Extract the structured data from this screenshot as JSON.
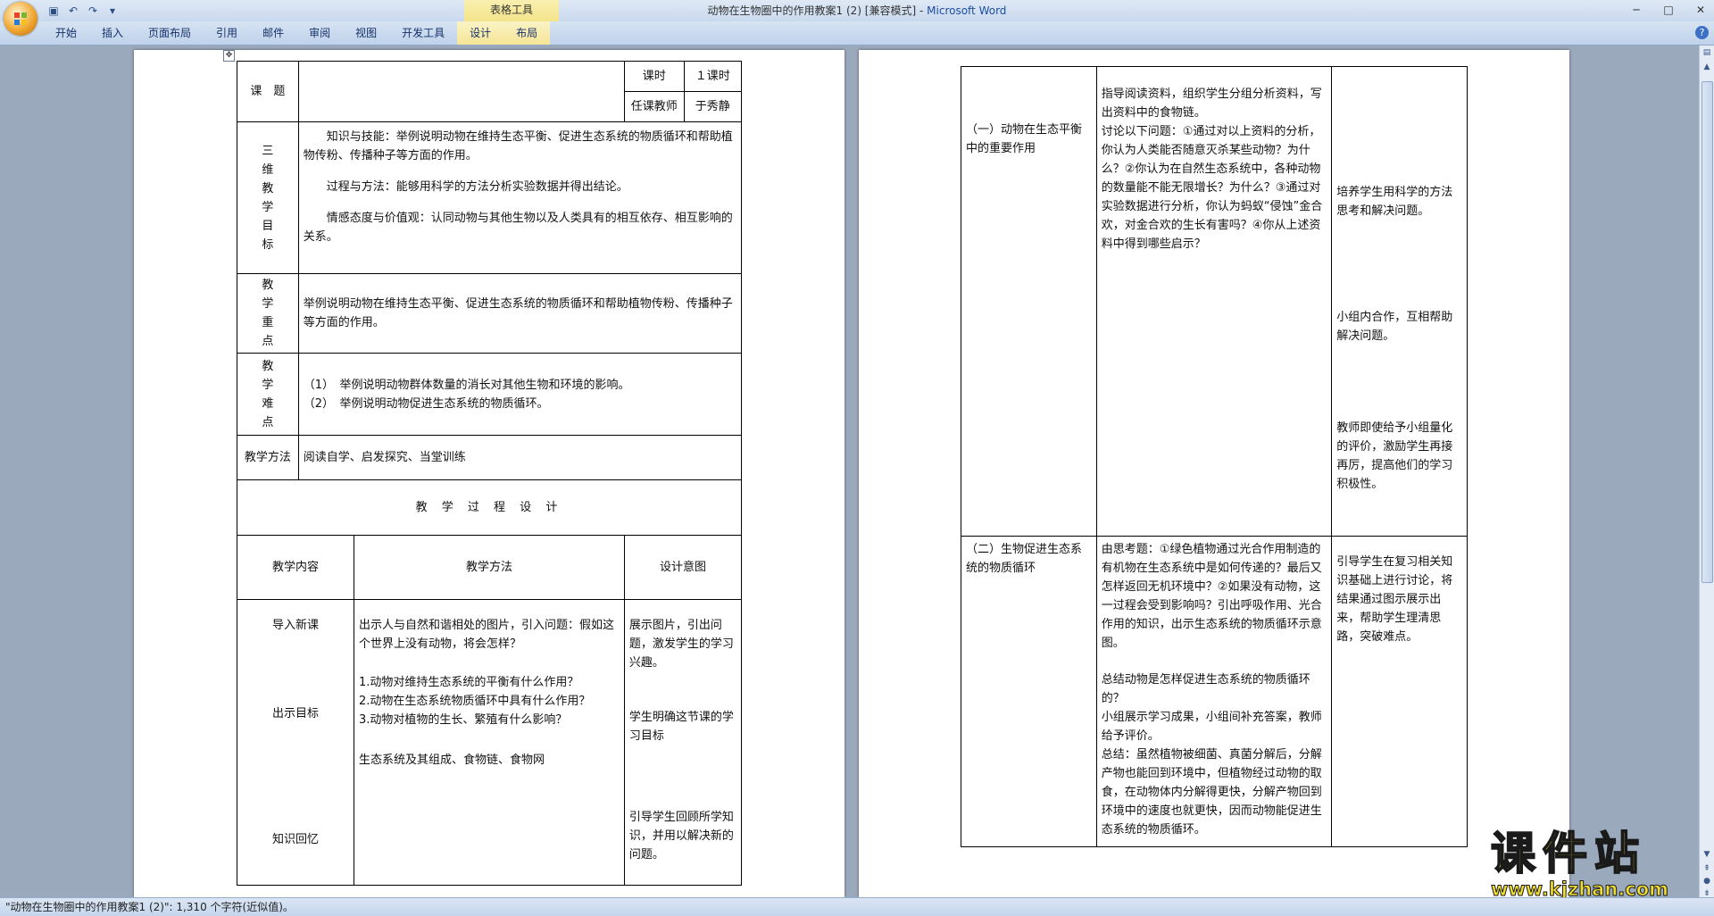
{
  "window": {
    "title": "动物在生物圈中的作用教案1 (2) [兼容模式]",
    "app_separator": " - ",
    "app_name": "Microsoft Word",
    "context_tab_group": "表格工具",
    "minimize": "─",
    "maximize": "□",
    "close": "✕"
  },
  "qat": [
    "save-icon",
    "undo-icon",
    "redo-icon",
    "customize-icon"
  ],
  "ribbon": {
    "tabs": [
      "开始",
      "插入",
      "页面布局",
      "引用",
      "邮件",
      "审阅",
      "视图",
      "开发工具",
      "设计",
      "布局"
    ],
    "help": "?"
  },
  "left_table": {
    "topic_label": "课　题",
    "topic_value": "",
    "class_hours_label": "课时",
    "class_hours_value": "１课时",
    "teacher_label": "任课教师",
    "teacher_value": "于秀静",
    "goals_label": "三\n维\n教\n学\n目\n标",
    "goal_knowledge": "知识与技能：举例说明动物在维持生态平衡、促进生态系统的物质循环和帮助植物传粉、传播种子等方面的作用。",
    "goal_process": "过程与方法：能够用科学的方法分析实验数据并得出结论。",
    "goal_emotion": "情感态度与价值观：认同动物与其他生物以及人类具有的相互依存、相互影响的关系。",
    "key_label": "教\n学\n重\n点",
    "key_value": "举例说明动物在维持生态平衡、促进生态系统的物质循环和帮助植物传粉、传播种子等方面的作用。",
    "difficulty_label": "教\n学\n难\n点",
    "difficulty_1": "（1）　举例说明动物群体数量的消长对其他生物和环境的影响。",
    "difficulty_2": "（2）　举例说明动物促进生态系统的物质循环。",
    "method_label": "教学方法",
    "method_value": "阅读自学、启发探究、当堂训练",
    "process_title": "教 学 过 程 设 计",
    "col_content": "教学内容",
    "col_method": "教学方法",
    "col_intent": "设计意图",
    "row_intro": "导入新课",
    "row_intro_method": "出示人与自然和谐相处的图片，引入问题：假如这个世界上没有动物，将会怎样？",
    "row_intro_intent": "展示图片，引出问题，激发学生的学习兴趣。",
    "row_goal": "出示目标",
    "row_goal_method_1": "1.动物对维持生态系统的平衡有什么作用？",
    "row_goal_method_2": "2.动物在生态系统物质循环中具有什么作用？",
    "row_goal_method_3": "3.动物对植物的生长、繁殖有什么影响？",
    "row_goal_intent": "学生明确这节课的学习目标",
    "row_review": "知识回忆",
    "row_review_method": "生态系统及其组成、食物链、食物网",
    "row_review_intent": "引导学生回顾所学知识，并用以解决新的问题。"
  },
  "right_table": {
    "sec1_title": "（一）动物在生态平衡中的重要作用",
    "sec1_method_1": "指导阅读资料，组织学生分组分析资料，写出资料中的食物链。",
    "sec1_method_2": "讨论以下问题：①通过对以上资料的分析，你认为人类能否随意灭杀某些动物？为什么？②你认为在自然生态系统中，各种动物的数量能不能无限增长？为什么？③通过对实验数据进行分析，你认为蚂蚁“侵蚀”金合欢，对金合欢的生长有害吗？④你从上述资料中得到哪些启示？",
    "sec1_intent_1": "培养学生用科学的方法思考和解决问题。",
    "sec1_intent_2": "小组内合作，互相帮助解决问题。",
    "sec1_intent_3": "教师即使给予小组量化的评价，激励学生再接再厉，提高他们的学习积极性。",
    "sec2_title": "（二）生物促进生态系统的物质循环",
    "sec2_method_1": "由思考题：①绿色植物通过光合作用制造的有机物在生态系统中是如何传递的？最后又怎样返回无机环境中？②如果没有动物，这一过程会受到影响吗？引出呼吸作用、光合作用的知识，出示生态系统的物质循环示意图。",
    "sec2_method_2": "总结动物是怎样促进生态系统的物质循环的？",
    "sec2_method_3": "小组展示学习成果，小组间补充答案，教师给予评价。",
    "sec2_method_4": "总结：虽然植物被细菌、真菌分解后，分解产物也能回到环境中，但植物经过动物的取食，在动物体内分解得更快，分解产物回到环境中的速度也就更快，因而动物能促进生态系统的物质循环。",
    "sec2_intent": "引导学生在复习相关知识基础上进行讨论，将结果通过图示展示出来，帮助学生理清思路，突破难点。"
  },
  "paragraph_mark": "↵",
  "status": {
    "text": "\"动物在生物圈中的作用教案1 (2)\": 1,310 个字符(近似值)。"
  },
  "watermark": {
    "logo_text": "课件站",
    "url": "www.kjzhan.com"
  },
  "colors": {
    "ribbon": "#c9d9ee",
    "context_tab": "#f4e48a",
    "workspace": "#9ba9bc",
    "watermark_fill": "#f0dd30"
  }
}
